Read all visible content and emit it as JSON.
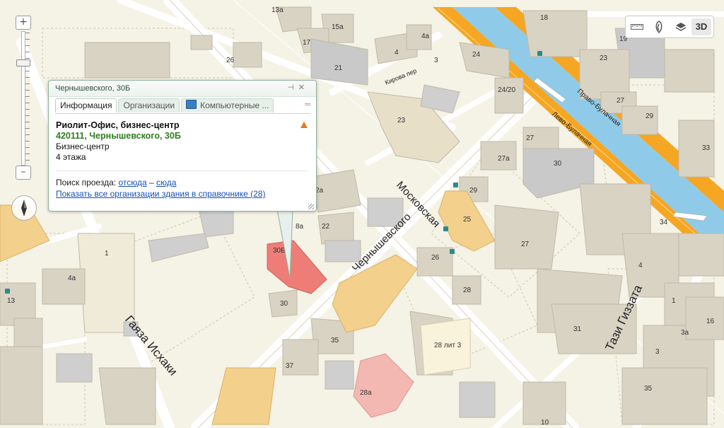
{
  "balloon": {
    "header_title": "Чернышевского, 30Б",
    "tabs": [
      {
        "label": "Информация"
      },
      {
        "label": "Организации"
      },
      {
        "label": "Компьютерные ..."
      }
    ],
    "org_name": "Риолит-Офис, бизнес-центр",
    "address": "420111, Чернышевского, 30Б",
    "type": "Бизнес-центр",
    "floors": "4 этажа",
    "route_prefix": "Поиск проезда:",
    "route_from": "отсюда",
    "route_dash": "–",
    "route_to": "сюда",
    "show_all": "Показать все организации здания в справочнике (28)"
  },
  "toolbar": {
    "mode_3d": "3D"
  },
  "zoom": {
    "plus": "+",
    "minus": "–",
    "level_fraction": 0.78
  },
  "streets": {
    "moskovskaya": "Московская",
    "chernyshevskogo": "Чернышевского",
    "gayaza": "Гаяза Исхаки",
    "tazi": "Тази Гиззата",
    "kirova": "Кирова пер",
    "pravo": "Право-Булачная",
    "levo": "Лево-Булачная"
  },
  "labels": {
    "b13a": "13а",
    "b15a": "15а",
    "b17": "17",
    "b4a_top": "4а",
    "b21": "21",
    "b4": "4",
    "b3": "3",
    "b24": "24",
    "b2420": "24/20",
    "b26": "26",
    "b23": "23",
    "b18": "18",
    "b19": "19",
    "b23r": "23",
    "b27r": "27",
    "b29r": "29",
    "b33": "33",
    "b27": "27",
    "b27a": "27а",
    "b30r": "30",
    "b29": "29",
    "b25": "25",
    "b22": "22",
    "b2a": "2а",
    "b8a": "8а",
    "b30b": "30Б",
    "b1": "1",
    "b4a": "4а",
    "b13": "13",
    "b30": "30",
    "b26b": "26",
    "b28": "28",
    "b27b": "27",
    "b34": "34",
    "b4r": "4",
    "b31": "31",
    "b1r": "1",
    "b16": "16",
    "b3a": "3а",
    "b35": "35",
    "b35r": "35",
    "b37": "37",
    "b28l3": "28 лит 3",
    "b28a": "28а",
    "b10": "10"
  },
  "colors": {
    "background": "#f5f2e6",
    "building": "#d9d3c4",
    "water": "#8fcbe8",
    "major_road": "#f5a623",
    "highlight_building": "#ee7d78",
    "yellow_building": "#f3d08b",
    "pink_building": "#f4b8b2",
    "link": "#1450b8",
    "address_green": "#2f7d1f"
  },
  "icons": [
    "ruler-icon",
    "traffic-icon",
    "layers-icon",
    "compass-icon",
    "warning-icon",
    "computer-icon",
    "pin-icon",
    "close-icon",
    "tab-menu-icon"
  ]
}
